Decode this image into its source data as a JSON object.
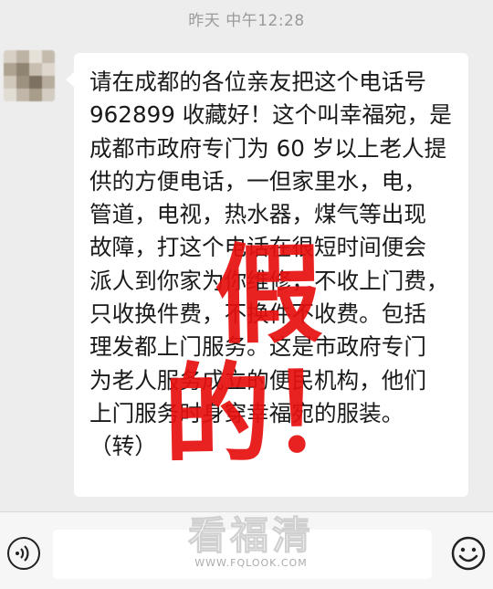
{
  "chat": {
    "timestamp": "昨天 中午12:28",
    "message": {
      "lines": [
        "请在成都的各位亲友把这个电话号",
        "962899 收藏好！这个叫幸福宛，是",
        "成都市政府专门为 60 岁以上老人提",
        "供的方便电话，一但家里水，电，",
        "管道，电视，热水器，煤气等出现",
        "故障，打这个电话在很短时间便会",
        "派人到你家为你维修，不收上门费，",
        "只收换件费，不换件不收费。包括",
        "理发都上门服务。这是市政府专门",
        "为老人服务成立的便民机构，他们",
        "上门服务时身穿幸福宛的服装。",
        "（转）"
      ],
      "stamp": "假的！"
    }
  },
  "input_bar": {
    "placeholder": ""
  },
  "watermark": {
    "main": "看福清",
    "url": "WWW.FQLOOK.COM"
  },
  "icons": {
    "voice": "voice-icon",
    "emoji": "emoji-icon"
  },
  "colors": {
    "background": "#ededed",
    "bubble": "#ffffff",
    "stamp": "#e61010",
    "timestamp": "#9a9a9a"
  }
}
